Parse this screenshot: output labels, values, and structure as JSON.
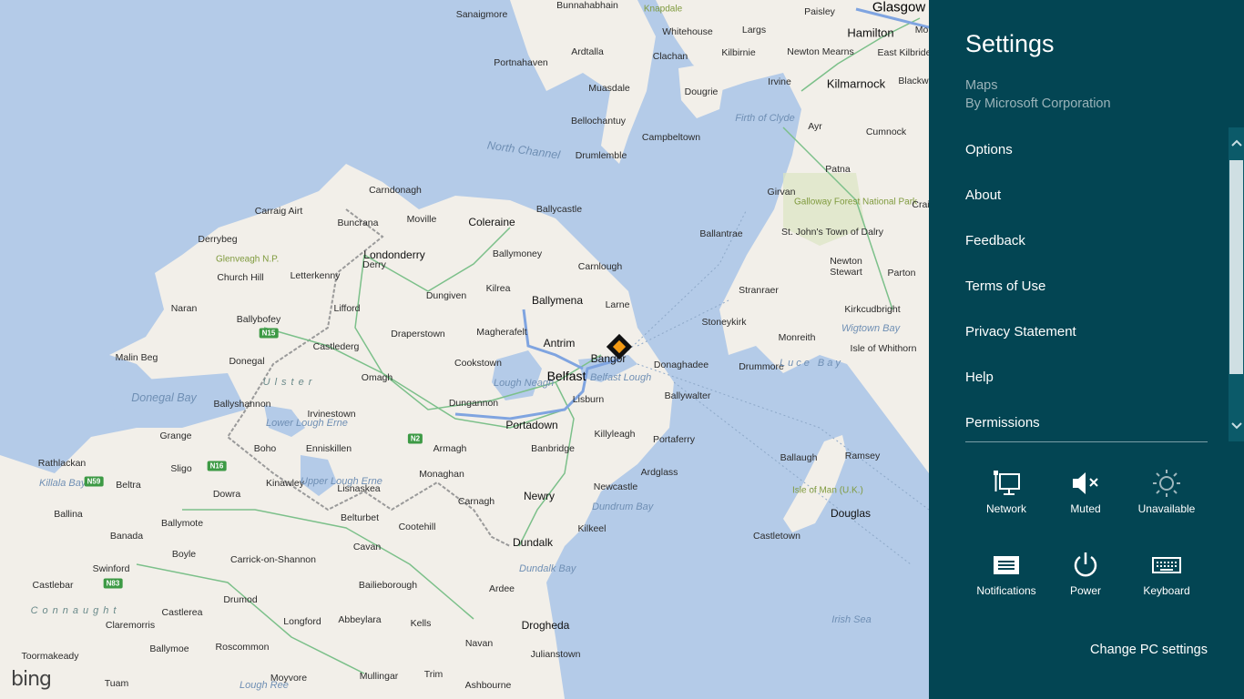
{
  "settings": {
    "title": "Settings",
    "app_name": "Maps",
    "app_publisher": "By Microsoft Corporation",
    "menu": [
      "Options",
      "About",
      "Feedback",
      "Terms of Use",
      "Privacy Statement",
      "Help",
      "Permissions"
    ],
    "tiles": [
      {
        "label": "Network",
        "icon": "network-icon"
      },
      {
        "label": "Muted",
        "icon": "speaker-muted-icon"
      },
      {
        "label": "Unavailable",
        "icon": "brightness-icon"
      },
      {
        "label": "Notifications",
        "icon": "notifications-icon"
      },
      {
        "label": "Power",
        "icon": "power-icon"
      },
      {
        "label": "Keyboard",
        "icon": "keyboard-icon"
      }
    ],
    "change_pc_settings": "Change PC settings",
    "colors": {
      "pane_bg": "#034553",
      "subtext": "#9ab3b9"
    }
  },
  "map": {
    "brand": "bing",
    "places": [
      "Sanaigmore",
      "Bunnahabhain",
      "Knapdale",
      "Paisley",
      "Glasgow",
      "Whitehouse",
      "Largs",
      "Hamilton",
      "Mo",
      "Ardtalla",
      "Portnahaven",
      "Clachan",
      "Kilbirnie",
      "Newton Mearns",
      "East Kilbride",
      "Muasdale",
      "Dougrie",
      "Irvine",
      "Kilmarnock",
      "Blackw",
      "Bellochantuy",
      "Firth of Clyde",
      "Ayr",
      "Campbeltown",
      "Cumnock",
      "North Channel",
      "Drumlemble",
      "Patna",
      "Carndonagh",
      "Ballycastle",
      "Girvan",
      "Galloway Forest National Park",
      "Crai",
      "Carraig Airt",
      "Buncrana",
      "Moville",
      "Coleraine",
      "Ballantrae",
      "St. John's Town of Dalry",
      "Derrybeg",
      "Ballymoney",
      "Glenveagh N.P.",
      "Londonderry",
      "Derry",
      "Carnlough",
      "Church Hill",
      "Letterkenny",
      "Dungiven",
      "Kilrea",
      "Ballymena",
      "Newton Stewart",
      "Parton",
      "Naran",
      "Lifford",
      "Larne",
      "Stranraer",
      "Kirkcudbright",
      "Ballybofey",
      "Draperstown",
      "Magherafelt",
      "Stoneykirk",
      "Wigtown Bay",
      "Castlederg",
      "Antrim",
      "Monreith",
      "Isle of Whithorn",
      "Malin Beg",
      "Donegal",
      "Omagh",
      "Bangor",
      "Donaghadee",
      "Drummore",
      "Luce Bay",
      "Cookstown",
      "Lough Neagh",
      "Belfast",
      "Belfast Lough",
      "Donegal Bay",
      "Ulster",
      "Ballyshannon",
      "Irvinestown",
      "Dungannon",
      "Lisburn",
      "Ballywalter",
      "Lower Lough Erne",
      "Portadown",
      "Grange",
      "Enniskillen",
      "Killyleagh",
      "Portaferry",
      "Boho",
      "Armagh",
      "Banbridge",
      "Ballaugh",
      "Ramsey",
      "Rathlackan",
      "Killala Bay",
      "Beltra",
      "Sligo",
      "Kinawley",
      "Upper Lough Erne",
      "Monaghan",
      "Ardglass",
      "Lisnaskea",
      "Newcastle",
      "Isle of Man (U.K.)",
      "Dowra",
      "Carnagh",
      "Newry",
      "Dundrum Bay",
      "Ballina",
      "Ballymote",
      "Belturbet",
      "Douglas",
      "Cootehill",
      "Kilkeel",
      "Castletown",
      "Banada",
      "Dundalk",
      "Boyle",
      "Carrick-on-Shannon",
      "Cavan",
      "Swinford",
      "Dundalk Bay",
      "Castlebar",
      "Bailieborough",
      "Ardee",
      "Connaught",
      "Drumod",
      "Castlerea",
      "Longford",
      "Abbeylara",
      "Kells",
      "Drogheda",
      "Claremorris",
      "Irish Sea",
      "Ballymoe",
      "Roscommon",
      "Navan",
      "Toormakeady",
      "Mullingar",
      "Trim",
      "Julianstown",
      "Tuam",
      "Moyvore",
      "Lough Ree",
      "Ashbourne"
    ],
    "road_shields": [
      "N15",
      "N2",
      "N16",
      "N59",
      "N83"
    ]
  }
}
